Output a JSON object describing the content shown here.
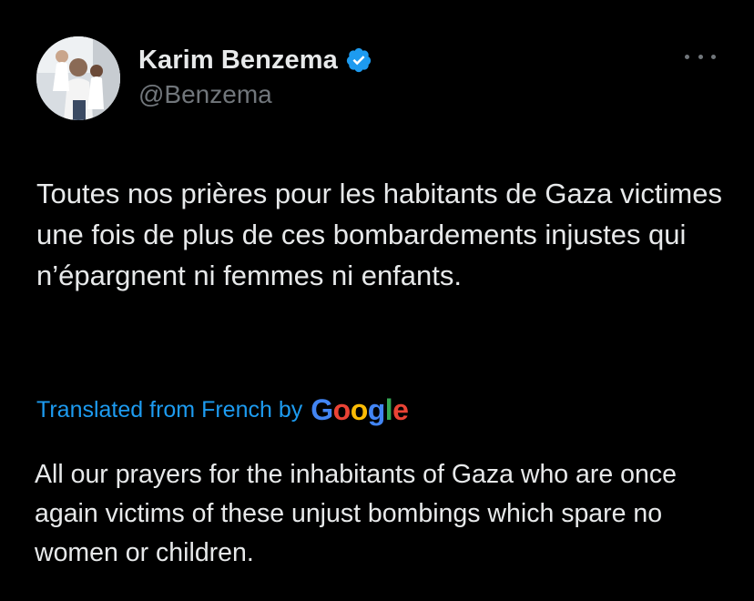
{
  "author": {
    "display_name": "Karim Benzema",
    "handle": "@Benzema",
    "verified": true,
    "verified_icon": "verified-badge-icon",
    "avatar_icon": "profile-avatar"
  },
  "more_icon": "more-options-icon",
  "tweet": {
    "text": "Toutes nos prières pour les habitants de Gaza victimes une fois de plus de ces bombardements injustes qui n’épargnent ni femmes ni enfants."
  },
  "translation": {
    "label": "Translated from French by",
    "provider_letters": [
      "G",
      "o",
      "o",
      "g",
      "l",
      "e"
    ],
    "text": "All our prayers for the inhabitants of Gaza who are once again victims of these unjust bombings which spare no women or children."
  },
  "colors": {
    "background": "#000000",
    "primary_text": "#e7e9ea",
    "secondary_text": "#71767b",
    "link_blue": "#1d9bf0",
    "verified_blue": "#1d9bf0"
  }
}
